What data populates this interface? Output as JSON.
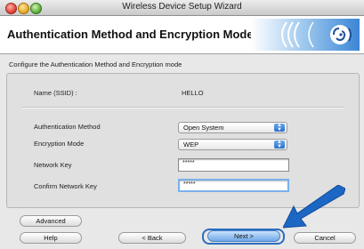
{
  "window": {
    "title": "Wireless Device Setup Wizard"
  },
  "header": {
    "title": "Authentication Method and Encryption Mode",
    "logo_icon": "wireless-signal-logo-icon"
  },
  "subtitle": "Configure the Authentication Method and Encryption mode",
  "form": {
    "name_label": "Name (SSID) :",
    "name_value": "HELLO",
    "auth_label": "Authentication Method",
    "auth_value": "Open System",
    "enc_label": "Encryption Mode",
    "enc_value": "WEP",
    "key_label": "Network Key",
    "key_value": "*****",
    "confirm_label": "Confirm Network Key",
    "confirm_value": "*****"
  },
  "buttons": {
    "advanced": "Advanced",
    "help": "Help",
    "back": "< Back",
    "next": "Next >",
    "cancel": "Cancel"
  },
  "colors": {
    "accent": "#2a6dc0",
    "arrow": "#1d67c4"
  }
}
